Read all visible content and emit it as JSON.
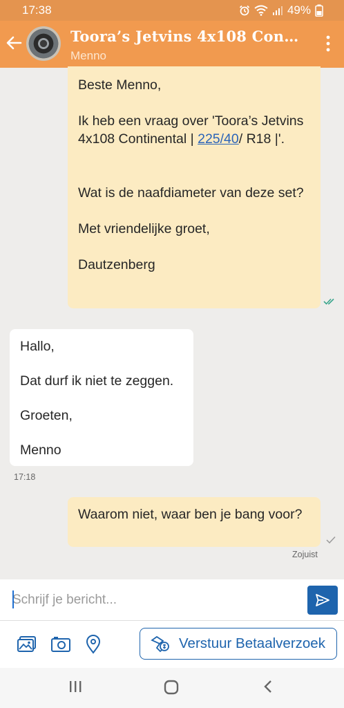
{
  "status_bar": {
    "time": "17:38",
    "battery": "49%",
    "icons": [
      "alarm-icon",
      "wifi-icon",
      "signal-icon",
      "battery-icon"
    ]
  },
  "header": {
    "title": "Toora’s Jetvins 4x108 Contine…",
    "subtitle": "Menno",
    "back_icon": "arrow-left-icon",
    "menu_icon": "more-vertical-icon",
    "accent_color": "#f19a4f"
  },
  "messages": [
    {
      "direction": "outgoing",
      "greeting": "Beste Menno,",
      "line1_before": "Ik heb een vraag over 'Toora’s Jetvins 4x108 Continental | ",
      "link": "225/40",
      "line1_after": "/ R18 |'.",
      "question": "Wat is de naafdiameter van deze set?",
      "closing": "Met vriendelijke groet,",
      "signature": "Dautzenberg",
      "status": "read"
    },
    {
      "direction": "incoming",
      "lines": [
        "Hallo,",
        "Dat durf ik niet te zeggen.",
        "Groeten,",
        "Menno"
      ],
      "time": "17:18"
    },
    {
      "direction": "outgoing",
      "text": "Waarom niet, waar ben je bang voor?",
      "time": "Zojuist",
      "status": "sent"
    }
  ],
  "compose": {
    "placeholder": "Schrijf je bericht...",
    "value": "",
    "send_icon": "send-icon"
  },
  "toolbar": {
    "icons": [
      "gallery-icon",
      "camera-icon",
      "location-pin-icon"
    ],
    "payment_button": "Verstuur Betaalverzoek",
    "button_color": "#1e64ad"
  },
  "nav": {
    "buttons": [
      "recent-apps-icon",
      "home-icon",
      "back-icon"
    ]
  }
}
